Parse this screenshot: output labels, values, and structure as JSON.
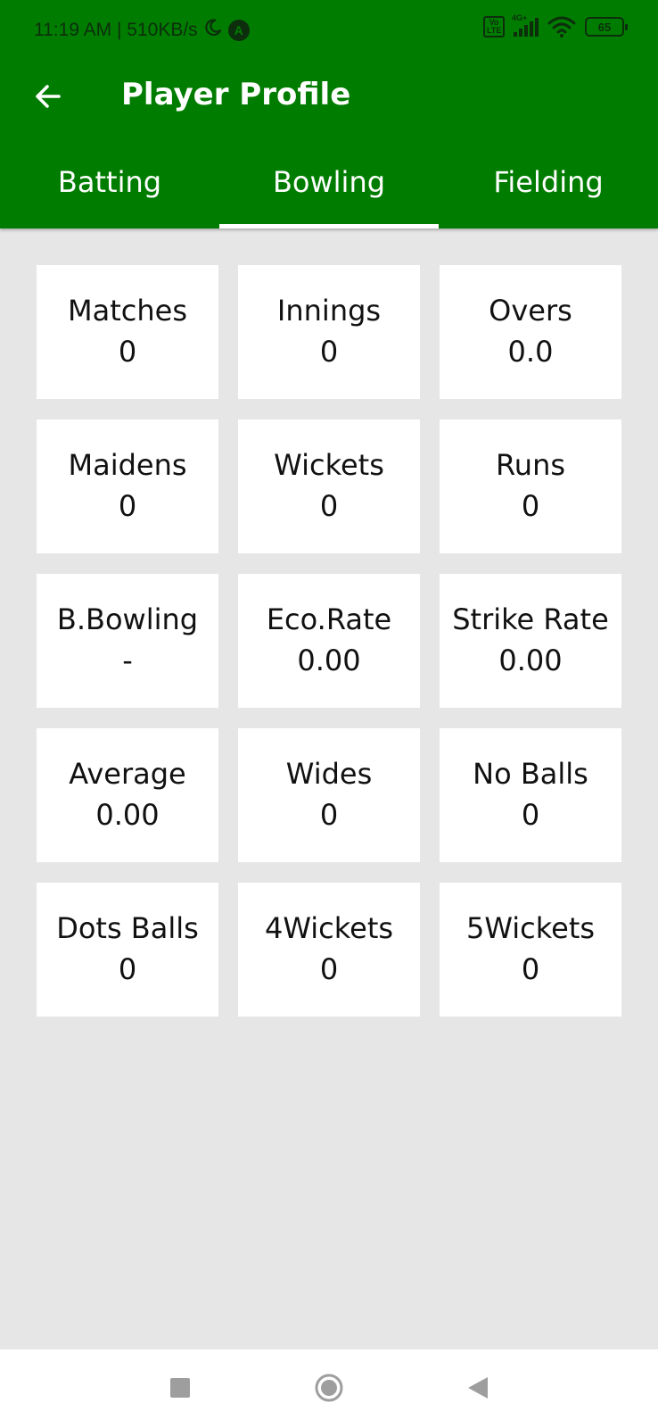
{
  "status_bar": {
    "time_speed": "11:19 AM | 510KB/s",
    "app_badge": "A",
    "volte": "Vo LTE",
    "network": "4G+",
    "battery": "65",
    "icons": [
      "moon-icon",
      "app-notification-icon",
      "volte-icon",
      "signal-icon",
      "wifi-icon",
      "battery-icon"
    ]
  },
  "toolbar": {
    "back_icon": "arrow-left-icon",
    "title": "Player Profile"
  },
  "tabs": [
    {
      "label": "Batting",
      "active": false
    },
    {
      "label": "Bowling",
      "active": true
    },
    {
      "label": "Fielding",
      "active": false
    }
  ],
  "stats": [
    {
      "label": "Matches",
      "value": "0"
    },
    {
      "label": "Innings",
      "value": "0"
    },
    {
      "label": "Overs",
      "value": "0.0"
    },
    {
      "label": "Maidens",
      "value": "0"
    },
    {
      "label": "Wickets",
      "value": "0"
    },
    {
      "label": "Runs",
      "value": "0"
    },
    {
      "label": "B.Bowling",
      "value": "-"
    },
    {
      "label": "Eco.Rate",
      "value": "0.00"
    },
    {
      "label": "Strike Rate",
      "value": "0.00"
    },
    {
      "label": "Average",
      "value": "0.00"
    },
    {
      "label": "Wides",
      "value": "0"
    },
    {
      "label": "No Balls",
      "value": "0"
    },
    {
      "label": "Dots Balls",
      "value": "0"
    },
    {
      "label": "4Wickets",
      "value": "0"
    },
    {
      "label": "5Wickets",
      "value": "0"
    }
  ],
  "colors": {
    "primary": "#007d00",
    "background": "#e6e6e6",
    "card": "#ffffff",
    "nav_icons": "#9e9e9e"
  },
  "nav_bar": {
    "icons": [
      "recents-square-icon",
      "home-circle-icon",
      "back-triangle-icon"
    ]
  }
}
